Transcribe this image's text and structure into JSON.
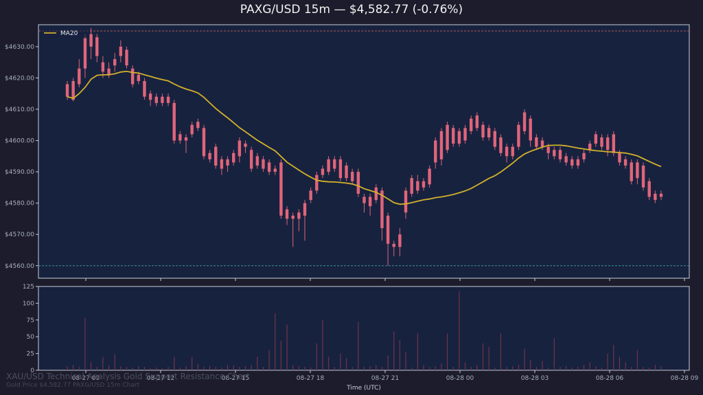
{
  "title": "PAXG/USD 15m — $4,582.77 (-0.76%)",
  "watermark": {
    "line1": "XAU/USD Technical Analysis Gold Support Resistance Chart",
    "line2": "Gold Price $4,582.77 PAXG/USD 15m Chart"
  },
  "colors": {
    "background": "#1c1c2c",
    "panel": "#17223f",
    "candle": "#e0657a",
    "ma": "#d4b12a",
    "resistance": "#c8605a",
    "support": "#3fa9a0",
    "volume": "#7a3648"
  },
  "chart_data": {
    "type": "candlestick",
    "x_axis": {
      "label": "Time (UTC)",
      "ticks": [
        "08-27 09",
        "08-27 12",
        "08-27 15",
        "08-27 18",
        "08-27 21",
        "08-28 00",
        "08-28 03",
        "08-28 06",
        "08-28 09"
      ]
    },
    "price_axis": {
      "range": [
        4556,
        4637
      ],
      "ticks": [
        4560,
        4570,
        4580,
        4590,
        4600,
        4610,
        4620,
        4630
      ],
      "tick_labels": [
        "$4560.00",
        "$4570.00",
        "$4580.00",
        "$4590.00",
        "$4600.00",
        "$4610.00",
        "$4620.00",
        "$4630.00"
      ]
    },
    "volume_axis": {
      "range": [
        0,
        125
      ],
      "ticks": [
        0,
        25,
        50,
        75,
        100,
        125
      ],
      "tick_labels": [
        "0",
        "25",
        "50",
        "75",
        "100",
        "125"
      ]
    },
    "legend": [
      {
        "name": "MA20",
        "position": "top-left"
      }
    ],
    "resistance_level": 4635,
    "support_level": 4560,
    "candles": [
      {
        "t": "08-27 07:45",
        "o": 4618.0,
        "h": 4619.0,
        "l": 4613.0,
        "c": 4614.0
      },
      {
        "t": "08-27 08:00",
        "o": 4619.0,
        "h": 4620.0,
        "l": 4612.5,
        "c": 4613.0
      },
      {
        "t": "08-27 08:15",
        "o": 4623.0,
        "h": 4626.0,
        "l": 4617.0,
        "c": 4618.0
      },
      {
        "t": "08-27 08:30",
        "o": 4633.0,
        "h": 4634.0,
        "l": 4620.0,
        "c": 4623.0
      },
      {
        "t": "08-27 08:45",
        "o": 4634.0,
        "h": 4636.0,
        "l": 4626.0,
        "c": 4630.0
      },
      {
        "t": "08-27 09:00",
        "o": 4633.0,
        "h": 4634.0,
        "l": 4625.0,
        "c": 4627.0
      },
      {
        "t": "08-27 09:15",
        "o": 4625.0,
        "h": 4627.0,
        "l": 4620.0,
        "c": 4622.0
      },
      {
        "t": "08-27 09:30",
        "o": 4623.0,
        "h": 4625.0,
        "l": 4620.0,
        "c": 4621.0
      },
      {
        "t": "08-27 09:45",
        "o": 4626.0,
        "h": 4628.0,
        "l": 4622.0,
        "c": 4624.0
      },
      {
        "t": "08-27 10:00",
        "o": 4630.0,
        "h": 4632.0,
        "l": 4625.0,
        "c": 4627.0
      },
      {
        "t": "08-27 10:15",
        "o": 4629.0,
        "h": 4630.0,
        "l": 4623.0,
        "c": 4624.0
      },
      {
        "t": "08-27 10:30",
        "o": 4623.0,
        "h": 4624.0,
        "l": 4617.0,
        "c": 4618.0
      },
      {
        "t": "08-27 10:45",
        "o": 4621.0,
        "h": 4622.0,
        "l": 4618.0,
        "c": 4619.0
      },
      {
        "t": "08-27 11:00",
        "o": 4619.0,
        "h": 4620.0,
        "l": 4613.0,
        "c": 4614.0
      },
      {
        "t": "08-27 11:15",
        "o": 4615.0,
        "h": 4616.0,
        "l": 4611.0,
        "c": 4613.0
      },
      {
        "t": "08-27 11:30",
        "o": 4614.0,
        "h": 4615.0,
        "l": 4611.0,
        "c": 4612.0
      },
      {
        "t": "08-27 11:45",
        "o": 4614.0,
        "h": 4615.0,
        "l": 4611.0,
        "c": 4612.0
      },
      {
        "t": "08-27 12:00",
        "o": 4614.0,
        "h": 4615.0,
        "l": 4611.0,
        "c": 4612.0
      },
      {
        "t": "08-27 12:15",
        "o": 4612.0,
        "h": 4613.0,
        "l": 4599.0,
        "c": 4600.0
      },
      {
        "t": "08-27 12:30",
        "o": 4602.0,
        "h": 4603.0,
        "l": 4599.0,
        "c": 4600.0
      },
      {
        "t": "08-27 12:45",
        "o": 4601.0,
        "h": 4602.0,
        "l": 4596.0,
        "c": 4600.0
      },
      {
        "t": "08-27 13:00",
        "o": 4605.0,
        "h": 4606.0,
        "l": 4601.0,
        "c": 4602.0
      },
      {
        "t": "08-27 13:15",
        "o": 4606.0,
        "h": 4607.0,
        "l": 4603.0,
        "c": 4604.0
      },
      {
        "t": "08-27 13:30",
        "o": 4604.0,
        "h": 4605.0,
        "l": 4594.0,
        "c": 4595.0
      },
      {
        "t": "08-27 13:45",
        "o": 4596.0,
        "h": 4597.0,
        "l": 4593.0,
        "c": 4594.0
      },
      {
        "t": "08-27 14:00",
        "o": 4598.0,
        "h": 4599.0,
        "l": 4591.0,
        "c": 4592.0
      },
      {
        "t": "08-27 14:15",
        "o": 4594.0,
        "h": 4595.0,
        "l": 4589.0,
        "c": 4591.0
      },
      {
        "t": "08-27 14:30",
        "o": 4594.0,
        "h": 4595.0,
        "l": 4590.0,
        "c": 4592.0
      },
      {
        "t": "08-27 14:45",
        "o": 4596.0,
        "h": 4597.0,
        "l": 4592.0,
        "c": 4593.0
      },
      {
        "t": "08-27 15:00",
        "o": 4600.0,
        "h": 4601.0,
        "l": 4593.0,
        "c": 4595.0
      },
      {
        "t": "08-27 15:15",
        "o": 4599.0,
        "h": 4600.0,
        "l": 4596.0,
        "c": 4598.0
      },
      {
        "t": "08-27 15:30",
        "o": 4597.0,
        "h": 4598.0,
        "l": 4590.0,
        "c": 4591.0
      },
      {
        "t": "08-27 15:45",
        "o": 4595.0,
        "h": 4596.0,
        "l": 4591.0,
        "c": 4592.0
      },
      {
        "t": "08-27 16:00",
        "o": 4594.0,
        "h": 4595.0,
        "l": 4590.0,
        "c": 4591.0
      },
      {
        "t": "08-27 16:15",
        "o": 4593.0,
        "h": 4594.0,
        "l": 4589.0,
        "c": 4590.0
      },
      {
        "t": "08-27 16:30",
        "o": 4591.0,
        "h": 4592.0,
        "l": 4589.0,
        "c": 4590.0
      },
      {
        "t": "08-27 16:45",
        "o": 4593.0,
        "h": 4594.0,
        "l": 4575.0,
        "c": 4576.0
      },
      {
        "t": "08-27 17:00",
        "o": 4578.0,
        "h": 4579.0,
        "l": 4573.0,
        "c": 4575.0
      },
      {
        "t": "08-27 17:15",
        "o": 4576.0,
        "h": 4577.0,
        "l": 4566.0,
        "c": 4575.0
      },
      {
        "t": "08-27 17:30",
        "o": 4577.0,
        "h": 4578.0,
        "l": 4571.0,
        "c": 4575.0
      },
      {
        "t": "08-27 17:45",
        "o": 4580.0,
        "h": 4581.0,
        "l": 4568.0,
        "c": 4576.0
      },
      {
        "t": "08-27 18:00",
        "o": 4584.0,
        "h": 4585.0,
        "l": 4580.0,
        "c": 4581.0
      },
      {
        "t": "08-27 18:15",
        "o": 4589.0,
        "h": 4590.0,
        "l": 4583.0,
        "c": 4584.0
      },
      {
        "t": "08-27 18:30",
        "o": 4591.0,
        "h": 4592.0,
        "l": 4588.0,
        "c": 4589.0
      },
      {
        "t": "08-27 18:45",
        "o": 4594.0,
        "h": 4595.0,
        "l": 4589.0,
        "c": 4590.0
      },
      {
        "t": "08-27 19:00",
        "o": 4594.0,
        "h": 4595.0,
        "l": 4590.0,
        "c": 4591.0
      },
      {
        "t": "08-27 19:15",
        "o": 4594.0,
        "h": 4595.0,
        "l": 4587.0,
        "c": 4588.0
      },
      {
        "t": "08-27 19:30",
        "o": 4592.0,
        "h": 4593.0,
        "l": 4587.0,
        "c": 4588.0
      },
      {
        "t": "08-27 19:45",
        "o": 4590.0,
        "h": 4591.0,
        "l": 4586.0,
        "c": 4587.0
      },
      {
        "t": "08-27 20:00",
        "o": 4590.0,
        "h": 4591.0,
        "l": 4582.0,
        "c": 4583.0
      },
      {
        "t": "08-27 20:15",
        "o": 4582.0,
        "h": 4583.0,
        "l": 4577.0,
        "c": 4580.0
      },
      {
        "t": "08-27 20:30",
        "o": 4582.0,
        "h": 4583.0,
        "l": 4576.0,
        "c": 4579.0
      },
      {
        "t": "08-27 20:45",
        "o": 4585.0,
        "h": 4586.0,
        "l": 4580.0,
        "c": 4581.0
      },
      {
        "t": "08-27 21:00",
        "o": 4584.0,
        "h": 4585.0,
        "l": 4568.0,
        "c": 4572.0
      },
      {
        "t": "08-27 21:15",
        "o": 4576.0,
        "h": 4577.0,
        "l": 4560.0,
        "c": 4567.0
      },
      {
        "t": "08-27 21:30",
        "o": 4567.0,
        "h": 4568.0,
        "l": 4563.0,
        "c": 4566.0
      },
      {
        "t": "08-27 21:45",
        "o": 4570.0,
        "h": 4572.0,
        "l": 4563.0,
        "c": 4566.0
      },
      {
        "t": "08-27 22:00",
        "o": 4584.0,
        "h": 4585.0,
        "l": 4575.0,
        "c": 4577.0
      },
      {
        "t": "08-27 22:15",
        "o": 4588.0,
        "h": 4589.0,
        "l": 4582.0,
        "c": 4583.0
      },
      {
        "t": "08-27 22:30",
        "o": 4587.0,
        "h": 4589.0,
        "l": 4583.0,
        "c": 4584.0
      },
      {
        "t": "08-27 22:45",
        "o": 4587.0,
        "h": 4588.0,
        "l": 4584.0,
        "c": 4585.0
      },
      {
        "t": "08-27 23:00",
        "o": 4591.0,
        "h": 4592.0,
        "l": 4585.0,
        "c": 4586.0
      },
      {
        "t": "08-27 23:15",
        "o": 4600.0,
        "h": 4601.0,
        "l": 4591.0,
        "c": 4593.0
      },
      {
        "t": "08-27 23:30",
        "o": 4603.0,
        "h": 4604.0,
        "l": 4592.0,
        "c": 4594.0
      },
      {
        "t": "08-27 23:45",
        "o": 4605.0,
        "h": 4606.0,
        "l": 4596.0,
        "c": 4597.0
      },
      {
        "t": "08-28 00:00",
        "o": 4604.0,
        "h": 4605.0,
        "l": 4598.0,
        "c": 4599.0
      },
      {
        "t": "08-28 00:15",
        "o": 4603.0,
        "h": 4604.0,
        "l": 4598.0,
        "c": 4599.0
      },
      {
        "t": "08-28 00:30",
        "o": 4604.0,
        "h": 4605.0,
        "l": 4599.0,
        "c": 4600.0
      },
      {
        "t": "08-28 00:45",
        "o": 4607.0,
        "h": 4608.0,
        "l": 4602.0,
        "c": 4603.0
      },
      {
        "t": "08-28 01:00",
        "o": 4608.0,
        "h": 4609.0,
        "l": 4603.0,
        "c": 4604.0
      },
      {
        "t": "08-28 01:15",
        "o": 4605.0,
        "h": 4606.0,
        "l": 4600.0,
        "c": 4601.0
      },
      {
        "t": "08-28 01:30",
        "o": 4604.0,
        "h": 4605.0,
        "l": 4600.0,
        "c": 4601.0
      },
      {
        "t": "08-28 01:45",
        "o": 4603.0,
        "h": 4604.0,
        "l": 4597.0,
        "c": 4598.0
      },
      {
        "t": "08-28 02:00",
        "o": 4601.0,
        "h": 4602.0,
        "l": 4595.0,
        "c": 4596.0
      },
      {
        "t": "08-28 02:15",
        "o": 4598.0,
        "h": 4599.0,
        "l": 4593.0,
        "c": 4595.0
      },
      {
        "t": "08-28 02:30",
        "o": 4598.0,
        "h": 4599.0,
        "l": 4594.0,
        "c": 4595.0
      },
      {
        "t": "08-28 02:45",
        "o": 4605.0,
        "h": 4606.0,
        "l": 4597.0,
        "c": 4598.0
      },
      {
        "t": "08-28 03:00",
        "o": 4609.0,
        "h": 4610.0,
        "l": 4602.0,
        "c": 4603.0
      },
      {
        "t": "08-28 03:15",
        "o": 4607.0,
        "h": 4608.0,
        "l": 4598.0,
        "c": 4600.0
      },
      {
        "t": "08-28 03:30",
        "o": 4601.0,
        "h": 4602.0,
        "l": 4597.0,
        "c": 4598.0
      },
      {
        "t": "08-28 03:45",
        "o": 4600.0,
        "h": 4601.0,
        "l": 4597.0,
        "c": 4598.0
      },
      {
        "t": "08-28 04:00",
        "o": 4598.0,
        "h": 4599.0,
        "l": 4594.0,
        "c": 4596.0
      },
      {
        "t": "08-28 04:15",
        "o": 4597.0,
        "h": 4598.0,
        "l": 4594.0,
        "c": 4595.0
      },
      {
        "t": "08-28 04:30",
        "o": 4597.0,
        "h": 4598.0,
        "l": 4593.0,
        "c": 4594.0
      },
      {
        "t": "08-28 04:45",
        "o": 4595.0,
        "h": 4596.0,
        "l": 4592.0,
        "c": 4593.0
      },
      {
        "t": "08-28 05:00",
        "o": 4594.0,
        "h": 4595.0,
        "l": 4591.0,
        "c": 4592.0
      },
      {
        "t": "08-28 05:15",
        "o": 4594.0,
        "h": 4595.0,
        "l": 4591.0,
        "c": 4592.0
      },
      {
        "t": "08-28 05:30",
        "o": 4596.0,
        "h": 4597.0,
        "l": 4593.0,
        "c": 4594.0
      },
      {
        "t": "08-28 05:45",
        "o": 4599.0,
        "h": 4600.0,
        "l": 4596.0,
        "c": 4597.0
      },
      {
        "t": "08-28 06:00",
        "o": 4602.0,
        "h": 4603.0,
        "l": 4598.0,
        "c": 4599.0
      },
      {
        "t": "08-28 06:15",
        "o": 4601.0,
        "h": 4602.0,
        "l": 4597.0,
        "c": 4598.0
      },
      {
        "t": "08-28 06:30",
        "o": 4601.0,
        "h": 4602.0,
        "l": 4595.0,
        "c": 4597.0
      },
      {
        "t": "08-28 06:45",
        "o": 4602.0,
        "h": 4603.0,
        "l": 4595.0,
        "c": 4596.0
      },
      {
        "t": "08-28 07:00",
        "o": 4596.0,
        "h": 4597.0,
        "l": 4592.0,
        "c": 4593.0
      },
      {
        "t": "08-28 07:15",
        "o": 4594.0,
        "h": 4595.0,
        "l": 4591.0,
        "c": 4592.0
      },
      {
        "t": "08-28 07:30",
        "o": 4593.0,
        "h": 4594.0,
        "l": 4586.0,
        "c": 4587.0
      },
      {
        "t": "08-28 07:45",
        "o": 4593.0,
        "h": 4594.0,
        "l": 4586.0,
        "c": 4588.0
      },
      {
        "t": "08-28 08:00",
        "o": 4592.0,
        "h": 4593.0,
        "l": 4584.0,
        "c": 4585.0
      },
      {
        "t": "08-28 08:15",
        "o": 4587.0,
        "h": 4588.0,
        "l": 4581.0,
        "c": 4582.0
      },
      {
        "t": "08-28 08:30",
        "o": 4583.0,
        "h": 4584.0,
        "l": 4580.0,
        "c": 4581.0
      },
      {
        "t": "08-28 08:45",
        "o": 4583.0,
        "h": 4584.0,
        "l": 4581.0,
        "c": 4582.0
      }
    ],
    "volumes": [
      6,
      8,
      5,
      78,
      12,
      5,
      20,
      7,
      24,
      6,
      5,
      4,
      6,
      5,
      3,
      4,
      3,
      5,
      20,
      4,
      6,
      20,
      10,
      5,
      6,
      5,
      4,
      8,
      7,
      5,
      6,
      8,
      20,
      5,
      30,
      85,
      44,
      68,
      8,
      6,
      5,
      4,
      40,
      75,
      20,
      5,
      25,
      18,
      5,
      72,
      5,
      6,
      8,
      5,
      22,
      58,
      45,
      27,
      4,
      55,
      8,
      5,
      6,
      10,
      55,
      5,
      118,
      12,
      5,
      8,
      40,
      35,
      4,
      55,
      5,
      6,
      8,
      32,
      15,
      5,
      14,
      4,
      48,
      5,
      6,
      4,
      5,
      8,
      12,
      6,
      4,
      25,
      38,
      20,
      12,
      5,
      30,
      5,
      4,
      8,
      6
    ]
  }
}
